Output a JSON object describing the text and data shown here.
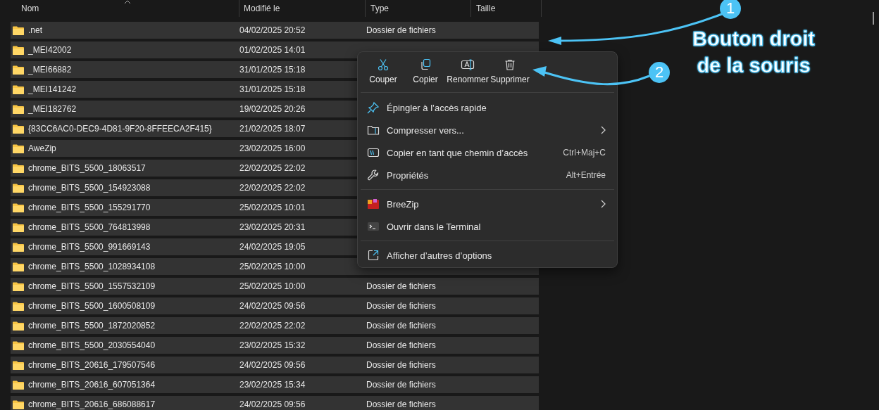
{
  "table": {
    "columns": [
      "Nom",
      "Modifié le",
      "Type",
      "Taille"
    ],
    "rows": [
      {
        "name": ".net",
        "modified": "04/02/2025 20:52",
        "type": "Dossier de fichiers",
        "selected": true
      },
      {
        "name": "_MEI42002",
        "modified": "01/02/2025 14:01",
        "selected": true
      },
      {
        "name": "_MEI66882",
        "modified": "31/01/2025 15:18",
        "selected": true
      },
      {
        "name": "_MEI141242",
        "modified": "31/01/2025 15:18",
        "selected": true
      },
      {
        "name": "_MEI182762",
        "modified": "19/02/2025 20:26",
        "selected": true
      },
      {
        "name": "{83CC6AC0-DEC9-4D81-9F20-8FFEECA2F415}",
        "modified": "21/02/2025 18:07",
        "selected": true
      },
      {
        "name": "AweZip",
        "modified": "23/02/2025 16:00",
        "selected": true
      },
      {
        "name": "chrome_BITS_5500_18063517",
        "modified": "22/02/2025 22:02",
        "selected": true
      },
      {
        "name": "chrome_BITS_5500_154923088",
        "modified": "22/02/2025 22:02",
        "selected": true
      },
      {
        "name": "chrome_BITS_5500_155291770",
        "modified": "25/02/2025 10:01",
        "selected": true
      },
      {
        "name": "chrome_BITS_5500_764813998",
        "modified": "23/02/2025 20:31",
        "selected": true
      },
      {
        "name": "chrome_BITS_5500_991669143",
        "modified": "24/02/2025 19:05",
        "selected": true
      },
      {
        "name": "chrome_BITS_5500_1028934108",
        "modified": "25/02/2025 10:00",
        "selected": true
      },
      {
        "name": "chrome_BITS_5500_1557532109",
        "modified": "25/02/2025 10:00",
        "type": "Dossier de fichiers",
        "selected": true
      },
      {
        "name": "chrome_BITS_5500_1600508109",
        "modified": "24/02/2025 09:56",
        "type": "Dossier de fichiers",
        "selected": true
      },
      {
        "name": "chrome_BITS_5500_1872020852",
        "modified": "22/02/2025 22:02",
        "type": "Dossier de fichiers",
        "selected": true
      },
      {
        "name": "chrome_BITS_5500_2030554040",
        "modified": "23/02/2025 15:32",
        "type": "Dossier de fichiers",
        "selected": true
      },
      {
        "name": "chrome_BITS_20616_179507546",
        "modified": "24/02/2025 09:56",
        "type": "Dossier de fichiers",
        "selected": true
      },
      {
        "name": "chrome_BITS_20616_607051364",
        "modified": "23/02/2025 15:34",
        "type": "Dossier de fichiers",
        "selected": true
      },
      {
        "name": "chrome_BITS_20616_686088617",
        "modified": "24/02/2025 09:56",
        "type": "Dossier de fichiers",
        "selected": true
      }
    ]
  },
  "context_menu": {
    "actions": [
      "Couper",
      "Copier",
      "Renommer",
      "Supprimer"
    ],
    "groups": [
      [
        {
          "label": "Épingler à l’accès rapide"
        },
        {
          "label": "Compresser vers...",
          "submenu": true
        },
        {
          "label": "Copier en tant que chemin d’accès",
          "shortcut": "Ctrl+Maj+C"
        },
        {
          "label": "Propriétés",
          "shortcut": "Alt+Entrée"
        }
      ],
      [
        {
          "label": "BreeZip",
          "submenu": true
        },
        {
          "label": "Ouvrir dans le Terminal"
        }
      ],
      [
        {
          "label": "Afficher d’autres d’options"
        }
      ]
    ]
  },
  "annotations": {
    "badges": [
      "1",
      "2"
    ],
    "caption": "Bouton droit de la souris"
  }
}
